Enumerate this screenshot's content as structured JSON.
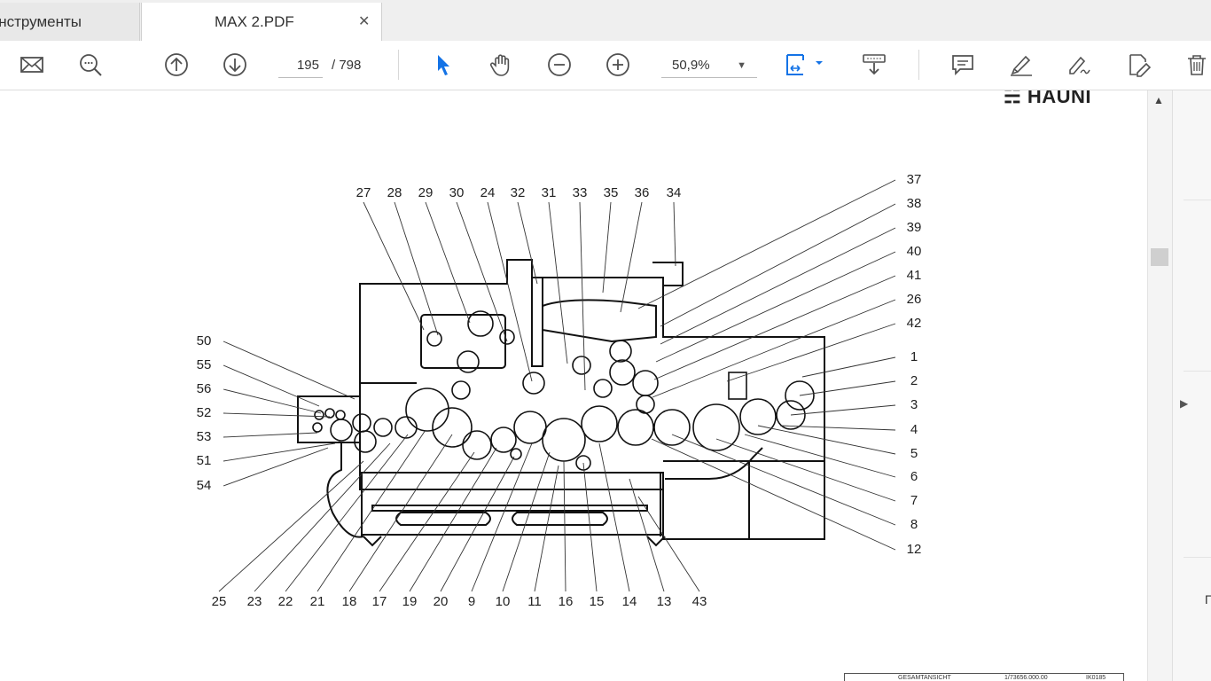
{
  "tabs": [
    {
      "label": "Инструменты",
      "active": false
    },
    {
      "label": "MAX 2.PDF",
      "active": true,
      "close_icon": "close-icon"
    }
  ],
  "toolbar": {
    "icons": [
      "mail-icon",
      "zoom-search-icon",
      "page-up-icon",
      "page-down-icon",
      "select-pointer-icon",
      "hand-tool-icon",
      "zoom-out-icon",
      "zoom-in-icon",
      "fit-page-icon",
      "scroll-mode-icon",
      "comment-icon",
      "highlight-icon",
      "sign-icon",
      "edit-pdf-icon",
      "delete-icon"
    ],
    "current_page": "195",
    "total_pages": "/ 798",
    "zoom": "50,9%"
  },
  "document": {
    "brand": "HAUNI",
    "top_labels": [
      "27",
      "28",
      "29",
      "30",
      "24",
      "32",
      "31",
      "33",
      "35",
      "36",
      "34"
    ],
    "right_labels": [
      "37",
      "38",
      "39",
      "40",
      "41",
      "26",
      "42",
      "1",
      "2",
      "3",
      "4",
      "5",
      "6",
      "7",
      "8",
      "12"
    ],
    "left_labels": [
      "50",
      "55",
      "56",
      "52",
      "53",
      "51",
      "54"
    ],
    "bottom_labels": [
      "25",
      "23",
      "22",
      "21",
      "18",
      "17",
      "19",
      "20",
      "9",
      "10",
      "11",
      "16",
      "15",
      "14",
      "13",
      "43"
    ],
    "title_block": [
      "GESAMTANSICHT",
      "1/73656.000.00",
      "IK0185"
    ]
  },
  "colors": {
    "accent": "#1473e6",
    "icon": "#505050"
  }
}
